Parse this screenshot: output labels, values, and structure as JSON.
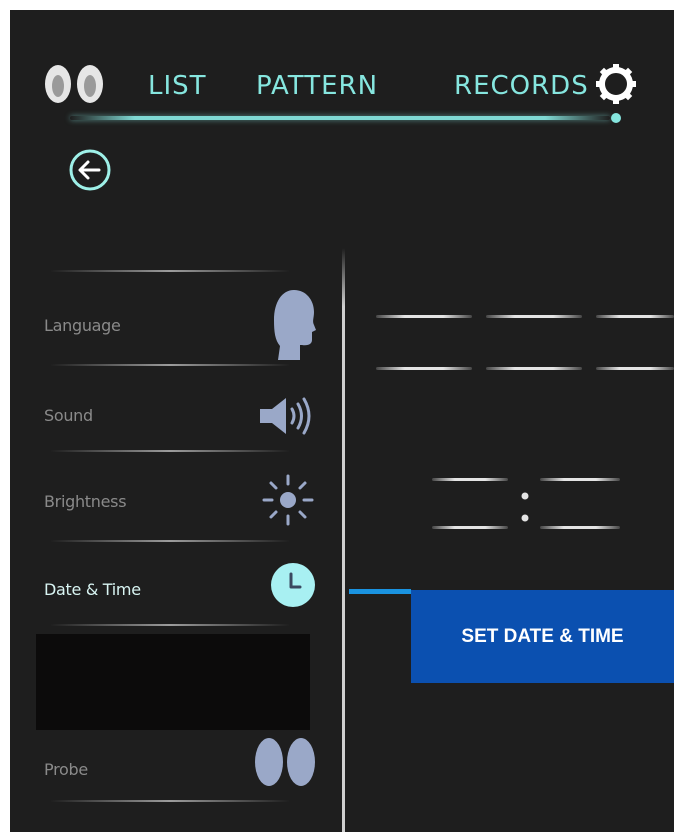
{
  "nav": {
    "tabs": [
      {
        "label": "LIST"
      },
      {
        "label": "PATTERN"
      },
      {
        "label": "RECORDS"
      }
    ]
  },
  "menu": {
    "items": [
      {
        "label": "Language",
        "icon": "head-profile-icon"
      },
      {
        "label": "Sound",
        "icon": "speaker-icon"
      },
      {
        "label": "Brightness",
        "icon": "sun-icon"
      },
      {
        "label": "Date & Time",
        "icon": "clock-icon",
        "active": true
      },
      {
        "label": "Probe",
        "icon": "probe-icon"
      }
    ]
  },
  "actions": {
    "set_date_time_label": "SET DATE & TIME"
  },
  "colors": {
    "accent_teal": "#86e6df",
    "button_blue": "#0b50b0",
    "indicator_blue": "#1a93e0",
    "background": "#1e1e1e"
  }
}
